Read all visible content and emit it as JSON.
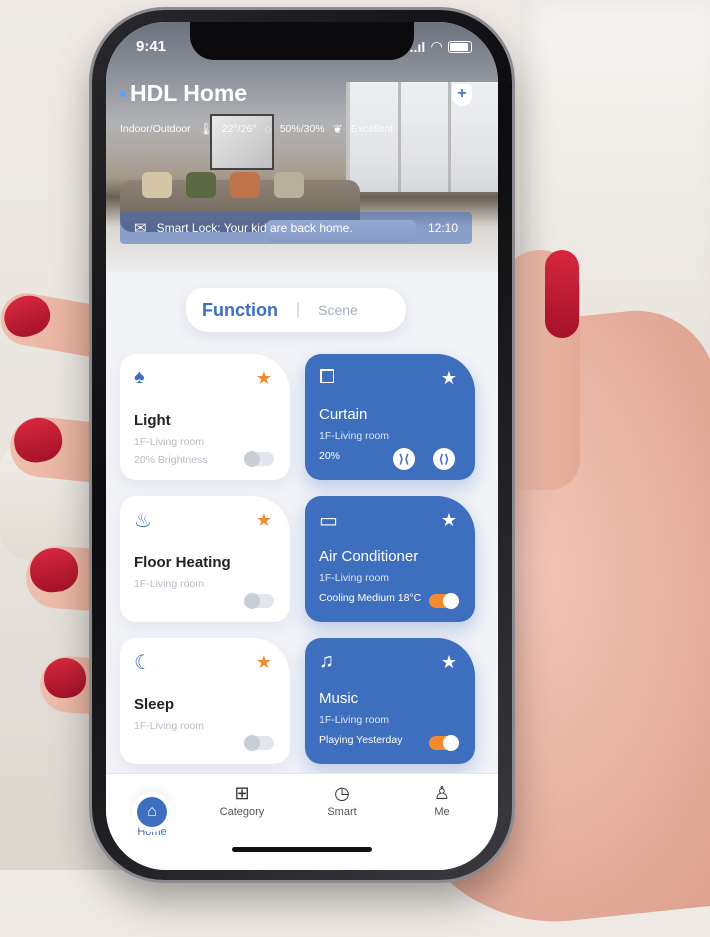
{
  "status_bar": {
    "time": "9:41",
    "signal": "..ıl",
    "wifi": "◠",
    "battery": "battery"
  },
  "header": {
    "title": "HDL Home",
    "env_label": "Indoor/Outdoor",
    "temperature": "22°/26°",
    "humidity": "50%/30%",
    "air_quality": "Excellent"
  },
  "notice": {
    "text": "Smart Lock: Your kid are back home.",
    "time": "12:10"
  },
  "segment": {
    "function": "Function",
    "separator": "|",
    "scene": "Scene"
  },
  "cards": [
    {
      "name": "Light",
      "room": "1F-Living room",
      "extra": "20% Brightness",
      "style": "white",
      "icon": "lamp-icon",
      "glyph": "♠",
      "favorite": true,
      "on": false
    },
    {
      "name": "Curtain",
      "room": "1F-Living room",
      "extra": "20%",
      "style": "blue",
      "icon": "curtain-icon",
      "glyph": "⧠",
      "favorite": true,
      "close_glyph": "⟩⟨",
      "open_glyph": "⟨⟩"
    },
    {
      "name": "Floor Heating",
      "room": "1F-Living room",
      "extra": "",
      "style": "white",
      "icon": "floor-heating-icon",
      "glyph": "♨",
      "favorite": true,
      "on": false
    },
    {
      "name": "Air Conditioner",
      "room": "1F-Living room",
      "extra": "Cooling Medium 18°C",
      "style": "blue",
      "icon": "air-conditioner-icon",
      "glyph": "▭",
      "favorite": true,
      "on": true
    },
    {
      "name": "Sleep",
      "room": "1F-Living room",
      "extra": "",
      "style": "white",
      "icon": "sleep-moon-icon",
      "glyph": "☾",
      "favorite": true,
      "on": false
    },
    {
      "name": "Music",
      "room": "1F-Living room",
      "extra": "Playing Yesterday",
      "style": "blue",
      "icon": "music-note-icon",
      "glyph": "♫",
      "favorite": true,
      "on": true
    }
  ],
  "tabbar": {
    "items": [
      {
        "label": "Home",
        "icon": "home-icon",
        "glyph": "⌂",
        "active": true
      },
      {
        "label": "Category",
        "icon": "category-grid-icon",
        "glyph": "⊞",
        "active": false
      },
      {
        "label": "Smart",
        "icon": "smart-clock-icon",
        "glyph": "◷",
        "active": false
      },
      {
        "label": "Me",
        "icon": "user-icon",
        "glyph": "♙",
        "active": false
      }
    ]
  },
  "colors": {
    "accent": "#3e6fbf",
    "favorite": "#f28a2f",
    "background": "#f2f3f7"
  }
}
